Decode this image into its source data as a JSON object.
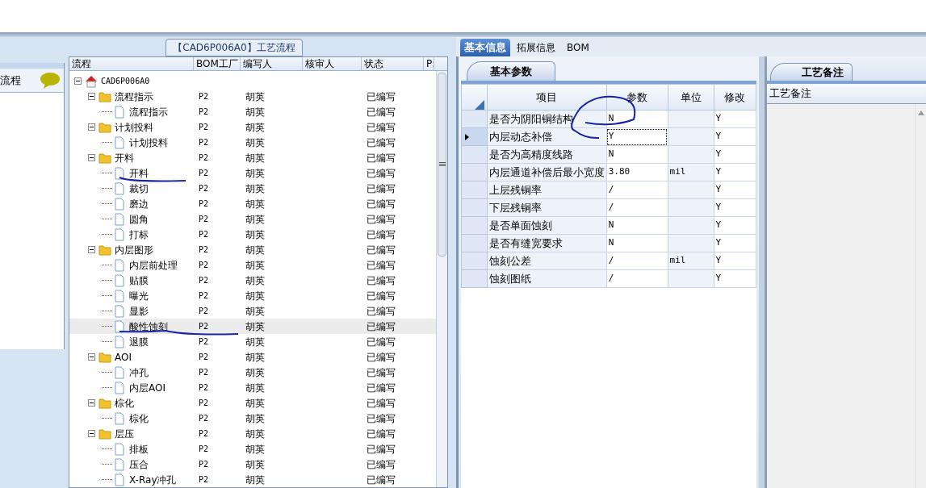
{
  "left_panel": {
    "item": "流程"
  },
  "process_panel": {
    "title": "【CAD6P006A0】工艺流程",
    "columns": [
      "流程",
      "BOM工厂",
      "编写人",
      "核审人",
      "状态",
      "P:"
    ],
    "tree": [
      {
        "label": "CAD6P006A0",
        "kind": "root",
        "expanded": true,
        "children": [
          {
            "label": "流程指示",
            "kind": "folder",
            "expanded": true,
            "factory": "P2",
            "author": "胡英",
            "status": "已编写",
            "selected": false,
            "children": [
              {
                "label": "流程指示",
                "kind": "step",
                "factory": "P2",
                "author": "胡英",
                "status": "已编写",
                "selected": false
              }
            ]
          },
          {
            "label": "计划投料",
            "kind": "folder",
            "expanded": true,
            "factory": "P2",
            "author": "胡英",
            "status": "已编写",
            "selected": false,
            "children": [
              {
                "label": "计划投料",
                "kind": "step",
                "factory": "P2",
                "author": "胡英",
                "status": "已编写",
                "selected": false
              }
            ]
          },
          {
            "label": "开料",
            "kind": "folder",
            "expanded": true,
            "factory": "P2",
            "author": "胡英",
            "status": "已编写",
            "selected": false,
            "children": [
              {
                "label": "开料",
                "kind": "step",
                "factory": "P2",
                "author": "胡英",
                "status": "已编写",
                "selected": false
              },
              {
                "label": "裁切",
                "kind": "step",
                "factory": "P2",
                "author": "胡英",
                "status": "已编写",
                "selected": false
              },
              {
                "label": "磨边",
                "kind": "step",
                "factory": "P2",
                "author": "胡英",
                "status": "已编写",
                "selected": false
              },
              {
                "label": "圆角",
                "kind": "step",
                "factory": "P2",
                "author": "胡英",
                "status": "已编写",
                "selected": false
              },
              {
                "label": "打标",
                "kind": "step",
                "factory": "P2",
                "author": "胡英",
                "status": "已编写",
                "selected": false
              }
            ]
          },
          {
            "label": "内层图形",
            "kind": "folder",
            "expanded": true,
            "factory": "P2",
            "author": "胡英",
            "status": "已编写",
            "selected": false,
            "children": [
              {
                "label": "内层前处理",
                "kind": "step",
                "factory": "P2",
                "author": "胡英",
                "status": "已编写",
                "selected": false
              },
              {
                "label": "贴膜",
                "kind": "step",
                "factory": "P2",
                "author": "胡英",
                "status": "已编写",
                "selected": false
              },
              {
                "label": "曝光",
                "kind": "step",
                "factory": "P2",
                "author": "胡英",
                "status": "已编写",
                "selected": false
              },
              {
                "label": "显影",
                "kind": "step",
                "factory": "P2",
                "author": "胡英",
                "status": "已编写",
                "selected": false
              },
              {
                "label": "酸性蚀刻",
                "kind": "step",
                "factory": "P2",
                "author": "胡英",
                "status": "已编写",
                "selected": true
              },
              {
                "label": "退膜",
                "kind": "step",
                "factory": "P2",
                "author": "胡英",
                "status": "已编写",
                "selected": false
              }
            ]
          },
          {
            "label": "AOI",
            "kind": "folder",
            "expanded": true,
            "factory": "P2",
            "author": "胡英",
            "status": "已编写",
            "selected": false,
            "children": [
              {
                "label": "冲孔",
                "kind": "step",
                "factory": "P2",
                "author": "胡英",
                "status": "已编写",
                "selected": false
              },
              {
                "label": "内层AOI",
                "kind": "step",
                "factory": "P2",
                "author": "胡英",
                "status": "已编写",
                "selected": false
              }
            ]
          },
          {
            "label": "棕化",
            "kind": "folder",
            "expanded": true,
            "factory": "P2",
            "author": "胡英",
            "status": "已编写",
            "selected": false,
            "children": [
              {
                "label": "棕化",
                "kind": "step",
                "factory": "P2",
                "author": "胡英",
                "status": "已编写",
                "selected": false
              }
            ]
          },
          {
            "label": "层压",
            "kind": "folder",
            "expanded": true,
            "factory": "P2",
            "author": "胡英",
            "status": "已编写",
            "selected": false,
            "children": [
              {
                "label": "排板",
                "kind": "step",
                "factory": "P2",
                "author": "胡英",
                "status": "已编写",
                "selected": false
              },
              {
                "label": "压合",
                "kind": "step",
                "factory": "P2",
                "author": "胡英",
                "status": "已编写",
                "selected": false
              },
              {
                "label": "X-Ray冲孔",
                "kind": "step",
                "factory": "P2",
                "author": "胡英",
                "status": "已编写",
                "selected": false
              }
            ]
          }
        ]
      }
    ]
  },
  "detail_panel": {
    "tabs": [
      {
        "label": "基本信息",
        "selected": true
      },
      {
        "label": "拓展信息",
        "selected": false
      },
      {
        "label": "BOM",
        "selected": false
      }
    ],
    "subtab": "基本参数",
    "columns": [
      "项目",
      "参数",
      "单位",
      "修改"
    ],
    "rows": [
      {
        "item": "是否为阴阳铜结构",
        "value": "N",
        "unit": "",
        "editable": "Y",
        "selected": false
      },
      {
        "item": "内层动态补偿",
        "value": "Y",
        "unit": "",
        "editable": "Y",
        "selected": true
      },
      {
        "item": "是否为高精度线路",
        "value": "N",
        "unit": "",
        "editable": "Y",
        "selected": false
      },
      {
        "item": "内层通道补偿后最小宽度",
        "value": "3.80",
        "unit": "mil",
        "editable": "Y",
        "selected": false
      },
      {
        "item": "上层残铜率",
        "value": "/",
        "unit": "",
        "editable": "Y",
        "selected": false
      },
      {
        "item": "下层残铜率",
        "value": "/",
        "unit": "",
        "editable": "Y",
        "selected": false
      },
      {
        "item": "是否单面蚀刻",
        "value": "N",
        "unit": "",
        "editable": "Y",
        "selected": false
      },
      {
        "item": "是否有缝宽要求",
        "value": "N",
        "unit": "",
        "editable": "Y",
        "selected": false
      },
      {
        "item": "蚀刻公差",
        "value": "/",
        "unit": "mil",
        "editable": "Y",
        "selected": false
      },
      {
        "item": "蚀刻图纸",
        "value": "/",
        "unit": "",
        "editable": "Y",
        "selected": false
      }
    ]
  },
  "notes_panel": {
    "tab": "工艺备注",
    "header": "工艺备注"
  }
}
